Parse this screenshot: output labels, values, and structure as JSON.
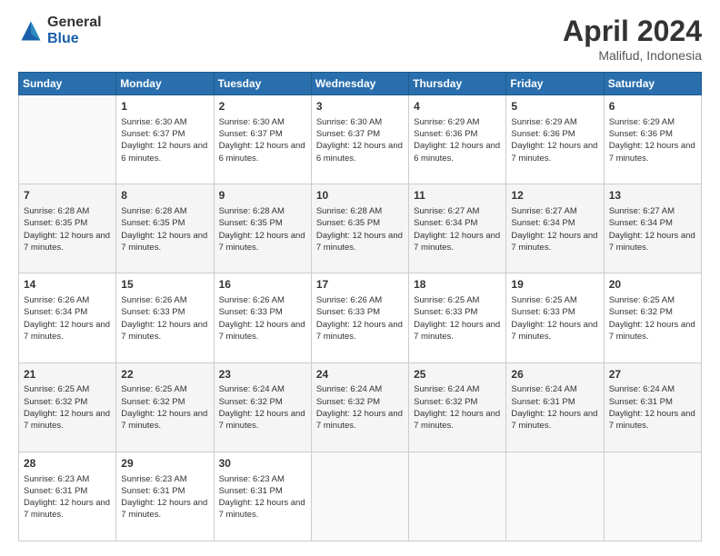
{
  "header": {
    "logo_general": "General",
    "logo_blue": "Blue",
    "month_title": "April 2024",
    "location": "Malifud, Indonesia"
  },
  "days_of_week": [
    "Sunday",
    "Monday",
    "Tuesday",
    "Wednesday",
    "Thursday",
    "Friday",
    "Saturday"
  ],
  "weeks": [
    [
      {
        "day": "",
        "sunrise": "",
        "sunset": "",
        "daylight": "",
        "empty": true
      },
      {
        "day": "1",
        "sunrise": "Sunrise: 6:30 AM",
        "sunset": "Sunset: 6:37 PM",
        "daylight": "Daylight: 12 hours and 6 minutes."
      },
      {
        "day": "2",
        "sunrise": "Sunrise: 6:30 AM",
        "sunset": "Sunset: 6:37 PM",
        "daylight": "Daylight: 12 hours and 6 minutes."
      },
      {
        "day": "3",
        "sunrise": "Sunrise: 6:30 AM",
        "sunset": "Sunset: 6:37 PM",
        "daylight": "Daylight: 12 hours and 6 minutes."
      },
      {
        "day": "4",
        "sunrise": "Sunrise: 6:29 AM",
        "sunset": "Sunset: 6:36 PM",
        "daylight": "Daylight: 12 hours and 6 minutes."
      },
      {
        "day": "5",
        "sunrise": "Sunrise: 6:29 AM",
        "sunset": "Sunset: 6:36 PM",
        "daylight": "Daylight: 12 hours and 7 minutes."
      },
      {
        "day": "6",
        "sunrise": "Sunrise: 6:29 AM",
        "sunset": "Sunset: 6:36 PM",
        "daylight": "Daylight: 12 hours and 7 minutes."
      }
    ],
    [
      {
        "day": "7",
        "sunrise": "Sunrise: 6:28 AM",
        "sunset": "Sunset: 6:35 PM",
        "daylight": "Daylight: 12 hours and 7 minutes."
      },
      {
        "day": "8",
        "sunrise": "Sunrise: 6:28 AM",
        "sunset": "Sunset: 6:35 PM",
        "daylight": "Daylight: 12 hours and 7 minutes."
      },
      {
        "day": "9",
        "sunrise": "Sunrise: 6:28 AM",
        "sunset": "Sunset: 6:35 PM",
        "daylight": "Daylight: 12 hours and 7 minutes."
      },
      {
        "day": "10",
        "sunrise": "Sunrise: 6:28 AM",
        "sunset": "Sunset: 6:35 PM",
        "daylight": "Daylight: 12 hours and 7 minutes."
      },
      {
        "day": "11",
        "sunrise": "Sunrise: 6:27 AM",
        "sunset": "Sunset: 6:34 PM",
        "daylight": "Daylight: 12 hours and 7 minutes."
      },
      {
        "day": "12",
        "sunrise": "Sunrise: 6:27 AM",
        "sunset": "Sunset: 6:34 PM",
        "daylight": "Daylight: 12 hours and 7 minutes."
      },
      {
        "day": "13",
        "sunrise": "Sunrise: 6:27 AM",
        "sunset": "Sunset: 6:34 PM",
        "daylight": "Daylight: 12 hours and 7 minutes."
      }
    ],
    [
      {
        "day": "14",
        "sunrise": "Sunrise: 6:26 AM",
        "sunset": "Sunset: 6:34 PM",
        "daylight": "Daylight: 12 hours and 7 minutes."
      },
      {
        "day": "15",
        "sunrise": "Sunrise: 6:26 AM",
        "sunset": "Sunset: 6:33 PM",
        "daylight": "Daylight: 12 hours and 7 minutes."
      },
      {
        "day": "16",
        "sunrise": "Sunrise: 6:26 AM",
        "sunset": "Sunset: 6:33 PM",
        "daylight": "Daylight: 12 hours and 7 minutes."
      },
      {
        "day": "17",
        "sunrise": "Sunrise: 6:26 AM",
        "sunset": "Sunset: 6:33 PM",
        "daylight": "Daylight: 12 hours and 7 minutes."
      },
      {
        "day": "18",
        "sunrise": "Sunrise: 6:25 AM",
        "sunset": "Sunset: 6:33 PM",
        "daylight": "Daylight: 12 hours and 7 minutes."
      },
      {
        "day": "19",
        "sunrise": "Sunrise: 6:25 AM",
        "sunset": "Sunset: 6:33 PM",
        "daylight": "Daylight: 12 hours and 7 minutes."
      },
      {
        "day": "20",
        "sunrise": "Sunrise: 6:25 AM",
        "sunset": "Sunset: 6:32 PM",
        "daylight": "Daylight: 12 hours and 7 minutes."
      }
    ],
    [
      {
        "day": "21",
        "sunrise": "Sunrise: 6:25 AM",
        "sunset": "Sunset: 6:32 PM",
        "daylight": "Daylight: 12 hours and 7 minutes."
      },
      {
        "day": "22",
        "sunrise": "Sunrise: 6:25 AM",
        "sunset": "Sunset: 6:32 PM",
        "daylight": "Daylight: 12 hours and 7 minutes."
      },
      {
        "day": "23",
        "sunrise": "Sunrise: 6:24 AM",
        "sunset": "Sunset: 6:32 PM",
        "daylight": "Daylight: 12 hours and 7 minutes."
      },
      {
        "day": "24",
        "sunrise": "Sunrise: 6:24 AM",
        "sunset": "Sunset: 6:32 PM",
        "daylight": "Daylight: 12 hours and 7 minutes."
      },
      {
        "day": "25",
        "sunrise": "Sunrise: 6:24 AM",
        "sunset": "Sunset: 6:32 PM",
        "daylight": "Daylight: 12 hours and 7 minutes."
      },
      {
        "day": "26",
        "sunrise": "Sunrise: 6:24 AM",
        "sunset": "Sunset: 6:31 PM",
        "daylight": "Daylight: 12 hours and 7 minutes."
      },
      {
        "day": "27",
        "sunrise": "Sunrise: 6:24 AM",
        "sunset": "Sunset: 6:31 PM",
        "daylight": "Daylight: 12 hours and 7 minutes."
      }
    ],
    [
      {
        "day": "28",
        "sunrise": "Sunrise: 6:23 AM",
        "sunset": "Sunset: 6:31 PM",
        "daylight": "Daylight: 12 hours and 7 minutes."
      },
      {
        "day": "29",
        "sunrise": "Sunrise: 6:23 AM",
        "sunset": "Sunset: 6:31 PM",
        "daylight": "Daylight: 12 hours and 7 minutes."
      },
      {
        "day": "30",
        "sunrise": "Sunrise: 6:23 AM",
        "sunset": "Sunset: 6:31 PM",
        "daylight": "Daylight: 12 hours and 7 minutes."
      },
      {
        "day": "",
        "sunrise": "",
        "sunset": "",
        "daylight": "",
        "empty": true
      },
      {
        "day": "",
        "sunrise": "",
        "sunset": "",
        "daylight": "",
        "empty": true
      },
      {
        "day": "",
        "sunrise": "",
        "sunset": "",
        "daylight": "",
        "empty": true
      },
      {
        "day": "",
        "sunrise": "",
        "sunset": "",
        "daylight": "",
        "empty": true
      }
    ]
  ]
}
